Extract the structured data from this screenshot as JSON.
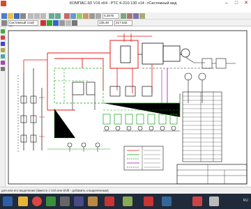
{
  "window": {
    "title": "КОМПАС-3D V16  x64 - РТС  К-210-130 v14 ->Системный вид",
    "minimize": "–",
    "maximize": "□",
    "close": "✕"
  },
  "menu": [
    "айл",
    "Инструменты",
    "Спецификация",
    "Сервис",
    "Окно",
    "Справка"
  ],
  "toolbar": {
    "zoom_value": "0.2678",
    "layer_value": "Системный слой (0)",
    "coord_x": "135.46",
    "coord_y": "217.542"
  },
  "status": {
    "message": "для или его выделение (вместе с Ctrl или Shift - добавить к выделенным)"
  },
  "taskbar": {
    "apps": [
      "file-explorer",
      "chrome",
      "kompas",
      "app4",
      "app5",
      "app6",
      "app7",
      "app8",
      "app9",
      "app10",
      "app11",
      "app12"
    ],
    "lang": "RU"
  },
  "colors": {
    "red": "#e01818",
    "green": "#12a012",
    "black": "#111111",
    "magenta": "#b000b0"
  }
}
